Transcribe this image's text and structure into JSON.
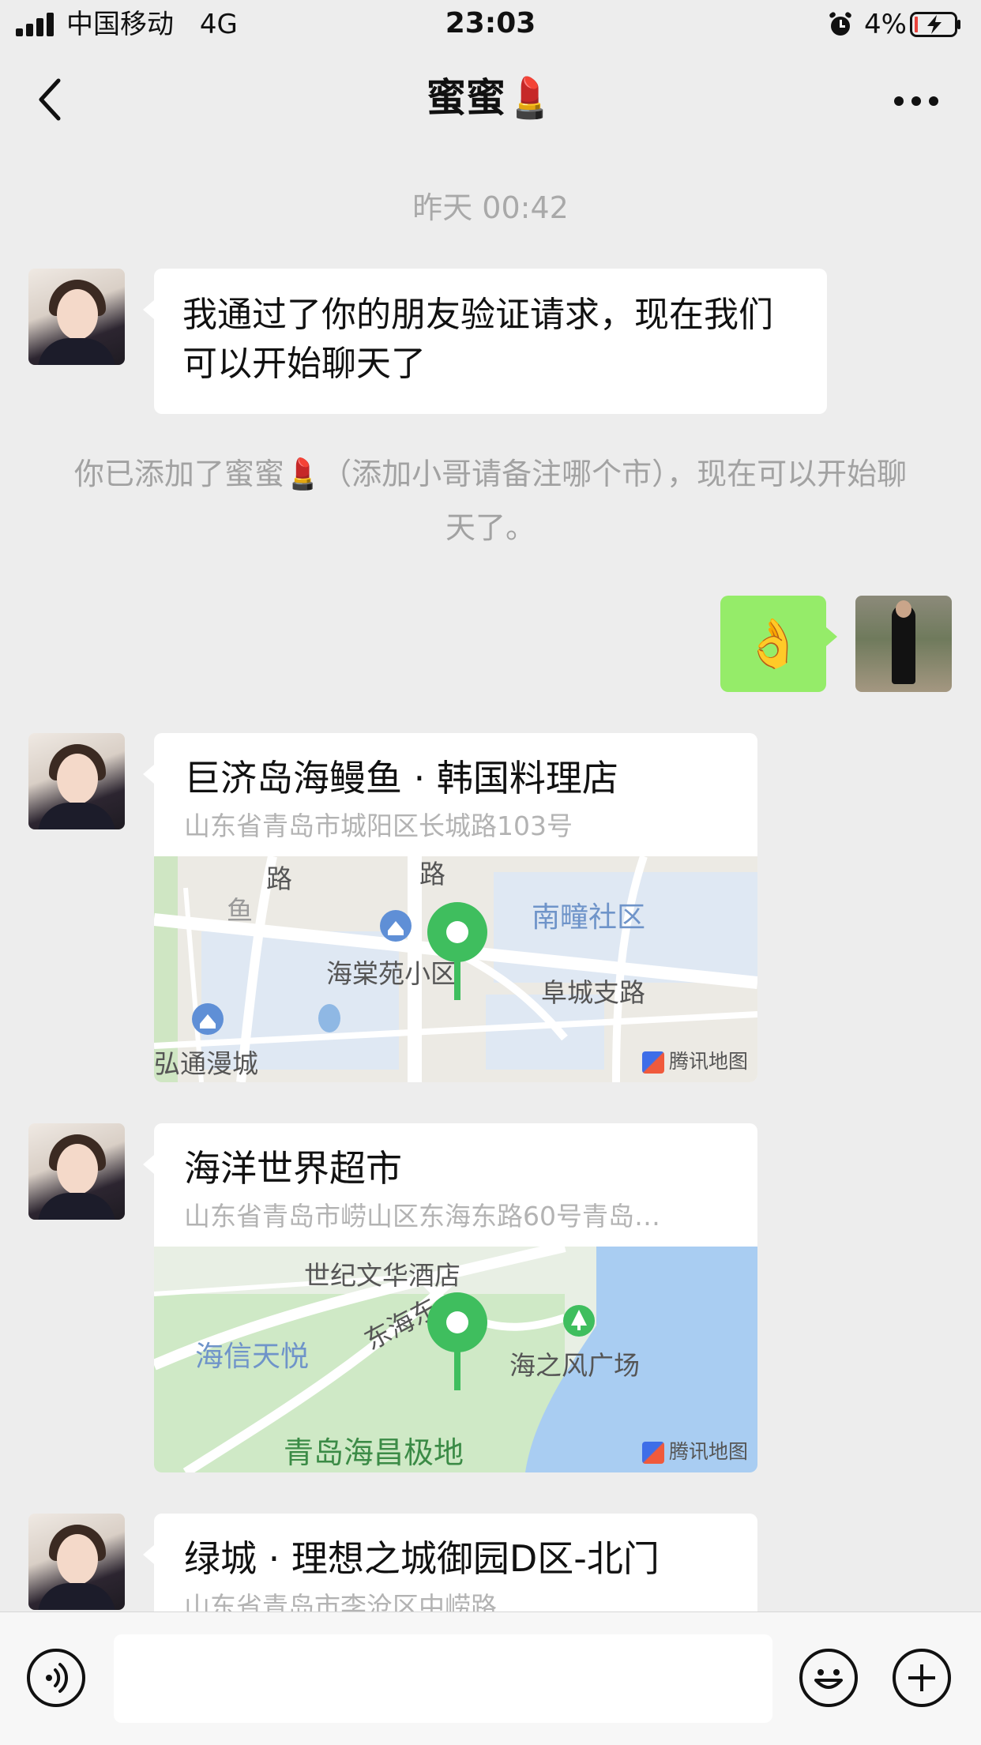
{
  "status_bar": {
    "carrier": "中国移动",
    "network": "4G",
    "time": "23:03",
    "battery_percent": "4%"
  },
  "nav": {
    "title": "蜜蜜💄"
  },
  "chat": {
    "timestamp": "昨天 00:42",
    "accepted_message": "我通过了你的朋友验证请求，现在我们可以开始聊天了",
    "system_note": "你已添加了蜜蜜💄（添加小哥请备注哪个市），现在可以开始聊天了。",
    "my_emoji": "👌",
    "locations": [
      {
        "name": "巨济岛海鳗鱼 · 韩国料理店",
        "address": "山东省青岛市城阳区长城路103号",
        "map_labels": [
          "路",
          "路",
          "南疃社区",
          "海棠苑小区",
          "阜城支路",
          "弘通漫城",
          "鱼"
        ],
        "map_brand": "腾讯地图"
      },
      {
        "name": "海洋世界超市",
        "address": "山东省青岛市崂山区东海东路60号青岛…",
        "map_labels": [
          "世纪文华酒店",
          "海信天悦",
          "东海东",
          "海之风广场",
          "青岛海昌极地"
        ],
        "map_brand": "腾讯地图"
      },
      {
        "name": "绿城 · 理想之城御园D区-北门",
        "address": "山东省青岛市李沧区中崂路"
      }
    ]
  },
  "icons": {
    "back": "chevron-left-icon",
    "more": "more-dots-icon",
    "voice": "voice-icon",
    "emoji": "emoji-icon",
    "add": "add-icon"
  },
  "colors": {
    "background": "#ededed",
    "self_bubble": "#95ec69",
    "map_pin": "#3fbe5e"
  }
}
